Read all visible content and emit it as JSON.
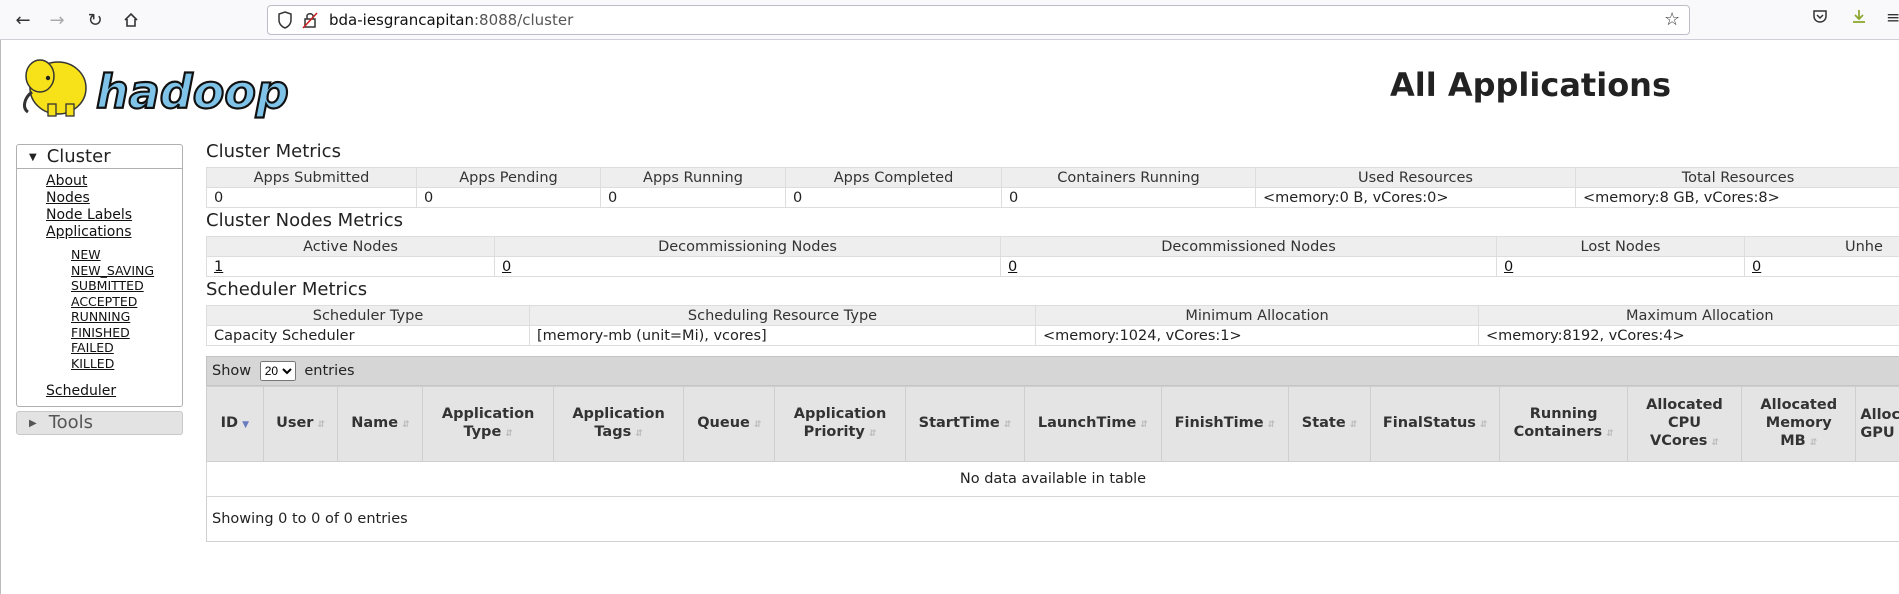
{
  "browser": {
    "url_host": "bda-iesgrancapitan",
    "url_rest": ":8088/cluster"
  },
  "page": {
    "title": "All Applications",
    "logo_text": "hadoop"
  },
  "sidebar": {
    "cluster_label": "Cluster",
    "links": [
      "About",
      "Nodes",
      "Node Labels",
      "Applications"
    ],
    "app_states": [
      "NEW",
      "NEW_SAVING",
      "SUBMITTED",
      "ACCEPTED",
      "RUNNING",
      "FINISHED",
      "FAILED",
      "KILLED"
    ],
    "scheduler_label": "Scheduler",
    "tools_label": "Tools"
  },
  "cluster_metrics": {
    "title": "Cluster Metrics",
    "headers": [
      "Apps Submitted",
      "Apps Pending",
      "Apps Running",
      "Apps Completed",
      "Containers Running",
      "Used Resources",
      "Total Resources"
    ],
    "values": [
      "0",
      "0",
      "0",
      "0",
      "0",
      "<memory:0 B, vCores:0>",
      "<memory:8 GB, vCores:8>"
    ]
  },
  "nodes_metrics": {
    "title": "Cluster Nodes Metrics",
    "headers": [
      "Active Nodes",
      "Decommissioning Nodes",
      "Decommissioned Nodes",
      "Lost Nodes",
      "Unhe"
    ],
    "values": [
      "1",
      "0",
      "0",
      "0",
      "0"
    ]
  },
  "scheduler_metrics": {
    "title": "Scheduler Metrics",
    "headers": [
      "Scheduler Type",
      "Scheduling Resource Type",
      "Minimum Allocation",
      "Maximum Allocation"
    ],
    "values": [
      "Capacity Scheduler",
      "[memory-mb (unit=Mi), vcores]",
      "<memory:1024, vCores:1>",
      "<memory:8192, vCores:4>"
    ]
  },
  "apps_table": {
    "show_label": "Show",
    "entries_label": "entries",
    "page_size": "20",
    "page_size_options": [
      "20"
    ],
    "columns": [
      "ID",
      "User",
      "Name",
      "Application Type",
      "Application Tags",
      "Queue",
      "Application Priority",
      "StartTime",
      "LaunchTime",
      "FinishTime",
      "State",
      "FinalStatus",
      "Running Containers",
      "Allocated CPU VCores",
      "Allocated Memory MB",
      "Alloca GPU"
    ],
    "empty_message": "No data available in table",
    "info": "Showing 0 to 0 of 0 entries"
  }
}
